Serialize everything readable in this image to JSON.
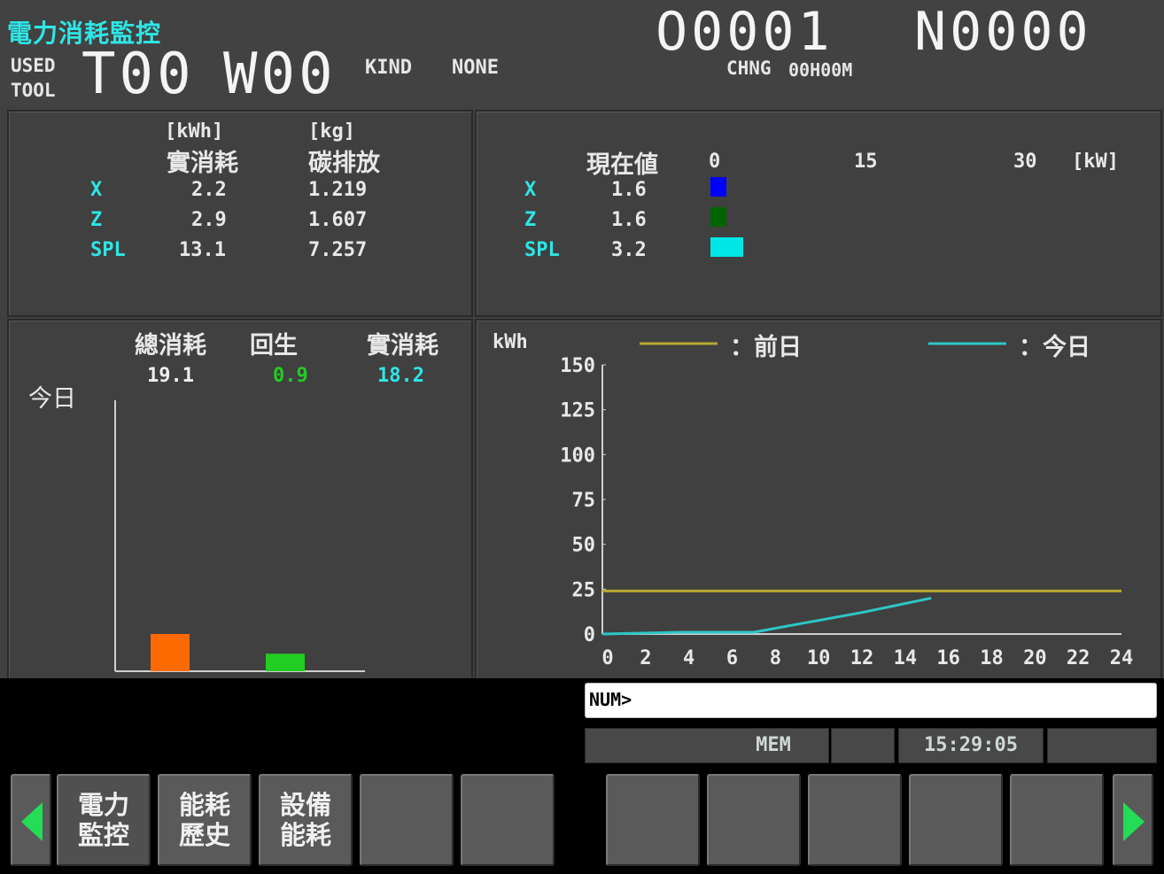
{
  "header": {
    "screen_title": "電力消耗監控",
    "used_label_1": "USED",
    "used_label_2": "TOOL",
    "tool_number": "T00",
    "wear_number": "W00",
    "kind_label": "KIND",
    "kind_value": "NONE",
    "program_number": "O0001",
    "sequence_number": "N0000",
    "chng_label": "CHNG",
    "chng_value": "00H00M"
  },
  "consumption_table": {
    "unit_energy": "[kWh]",
    "unit_mass": "[kg]",
    "col_actual": "實消耗",
    "col_carbon": "碳排放",
    "rows": [
      {
        "axis": "X",
        "actual": "2.2",
        "carbon": "1.219"
      },
      {
        "axis": "Z",
        "actual": "2.9",
        "carbon": "1.607"
      },
      {
        "axis": "SPL",
        "actual": "13.1",
        "carbon": "7.257"
      }
    ]
  },
  "current_power": {
    "col_current": "現在値",
    "scale_0": "0",
    "scale_15": "15",
    "scale_30": "30",
    "unit": "[kW]",
    "scale_max": 30,
    "rows": [
      {
        "axis": "X",
        "value": "1.6",
        "num": 1.6,
        "color": "#0000ff"
      },
      {
        "axis": "Z",
        "value": "1.6",
        "num": 1.6,
        "color": "#006400"
      },
      {
        "axis": "SPL",
        "value": "3.2",
        "num": 3.2,
        "color": "#00e6e6"
      }
    ]
  },
  "today_summary": {
    "label_today": "今日",
    "col_total": "總消耗",
    "col_regen": "回生",
    "col_actual": "實消耗",
    "total": "19.1",
    "regen": "0.9",
    "actual": "18.2",
    "bar_colors": {
      "total": "#ff6a00",
      "regen": "#22cc22"
    }
  },
  "chart_data": {
    "type": "line",
    "ylabel": "kWh",
    "ylim": [
      0,
      150
    ],
    "yticks": [
      "150",
      "125",
      "100",
      "75",
      "50",
      "25",
      "0"
    ],
    "xlim": [
      0,
      24
    ],
    "xticks": [
      "0",
      "2",
      "4",
      "6",
      "8",
      "10",
      "12",
      "14",
      "16",
      "18",
      "20",
      "22",
      "24"
    ],
    "legend": [
      {
        "name": "：前日",
        "color": "#b8a830"
      },
      {
        "name": "：今日",
        "color": "#2ec6c6"
      }
    ],
    "series": [
      {
        "name": "前日",
        "color": "#b8a830",
        "x": [
          0,
          24
        ],
        "y": [
          24,
          24
        ]
      },
      {
        "name": "今日",
        "color": "#2ec6c6",
        "x": [
          0,
          3.7,
          7,
          12,
          15.2
        ],
        "y": [
          0,
          1,
          1,
          12,
          20
        ]
      }
    ]
  },
  "command": {
    "prompt": "NUM>"
  },
  "status": {
    "mode": "MEM",
    "time": "15:29:05"
  },
  "softkeys": [
    {
      "line1": "電力",
      "line2": "監控"
    },
    {
      "line1": "能耗",
      "line2": "歷史"
    },
    {
      "line1": "設備",
      "line2": "能耗"
    }
  ]
}
